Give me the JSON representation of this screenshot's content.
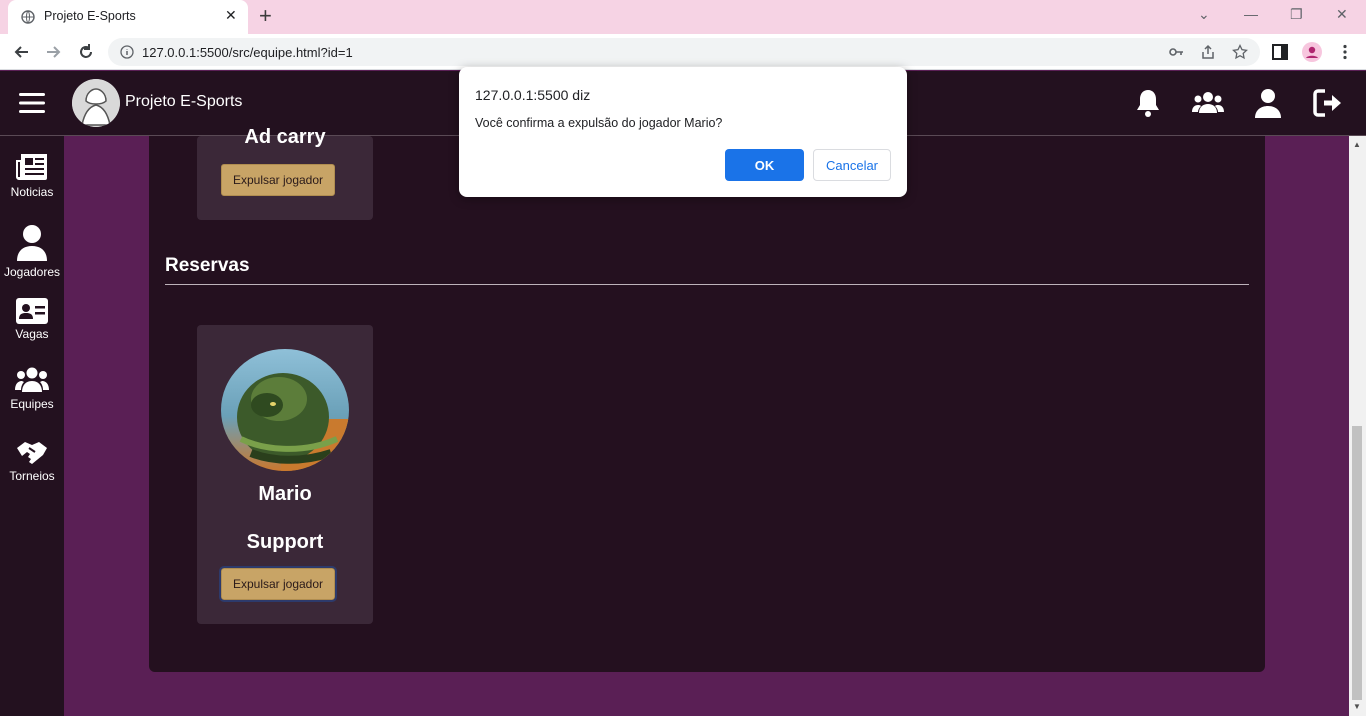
{
  "browser": {
    "tab_title": "Projeto E-Sports",
    "url": "127.0.0.1:5500/src/equipe.html?id=1"
  },
  "app": {
    "brand": "Projeto E-Sports",
    "header_icons": [
      "bell-icon",
      "team-icon",
      "user-icon",
      "logout-icon"
    ],
    "sidebar": {
      "items": [
        {
          "label": "Noticias",
          "icon": "newspaper-icon"
        },
        {
          "label": "Jogadores",
          "icon": "user-icon"
        },
        {
          "label": "Vagas",
          "icon": "id-card-icon"
        },
        {
          "label": "Equipes",
          "icon": "users-icon"
        },
        {
          "label": "Torneios",
          "icon": "handshake-icon"
        }
      ]
    }
  },
  "team": {
    "top_card": {
      "role": "Ad carry",
      "button_label": "Expulsar jogador"
    },
    "reserves_title": "Reservas",
    "reserve_card": {
      "name": "Mario",
      "role": "Support",
      "button_label": "Expulsar jogador"
    }
  },
  "dialog": {
    "title": "127.0.0.1:5500 diz",
    "message": "Você confirma a expulsão do jogador Mario?",
    "ok_label": "OK",
    "cancel_label": "Cancelar"
  },
  "colors": {
    "accent_button": "#c8a466",
    "background": "#5a1f55",
    "panel": "#24101f",
    "card": "#3b2838",
    "dialog_primary": "#1a73e8"
  }
}
